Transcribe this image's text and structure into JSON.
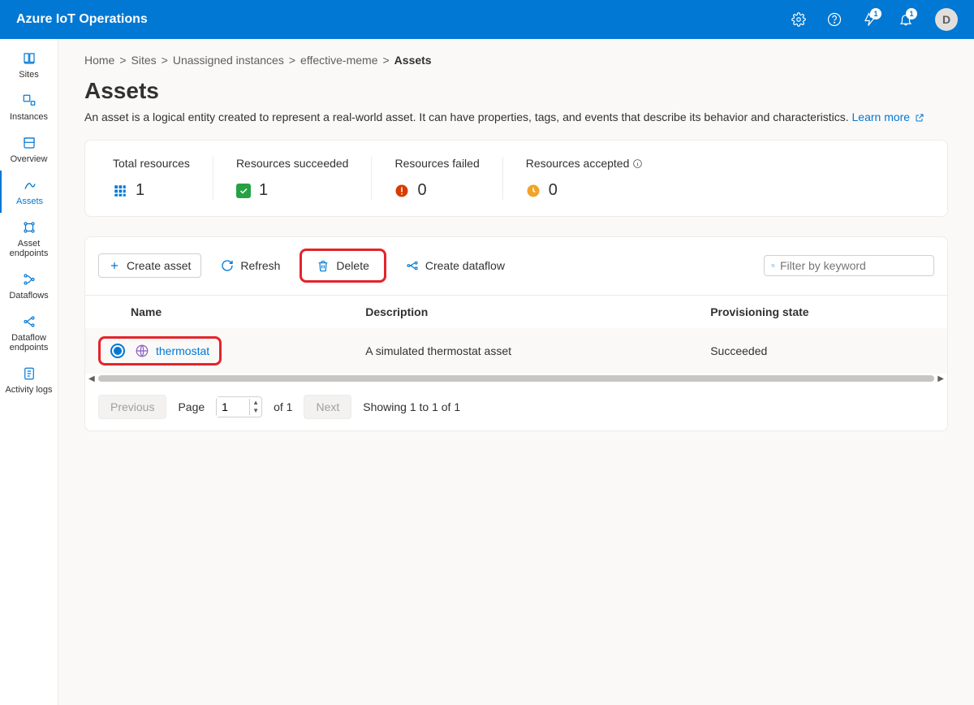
{
  "header": {
    "brand": "Azure IoT Operations",
    "notif1_count": "1",
    "notif2_count": "1",
    "avatar_initial": "D"
  },
  "sidebar": {
    "items": [
      {
        "label": "Sites"
      },
      {
        "label": "Instances"
      },
      {
        "label": "Overview"
      },
      {
        "label": "Assets"
      },
      {
        "label": "Asset endpoints"
      },
      {
        "label": "Dataflows"
      },
      {
        "label": "Dataflow endpoints"
      },
      {
        "label": "Activity logs"
      }
    ]
  },
  "breadcrumbs": {
    "items": [
      "Home",
      "Sites",
      "Unassigned instances",
      "effective-meme"
    ],
    "current": "Assets"
  },
  "page": {
    "title": "Assets",
    "description_prefix": "An asset is a logical entity created to represent a real-world asset. It can have properties, tags, and events that describe its behavior and characteristics. ",
    "learn_more": "Learn more"
  },
  "stats": {
    "total": {
      "label": "Total resources",
      "value": "1"
    },
    "succeeded": {
      "label": "Resources succeeded",
      "value": "1"
    },
    "failed": {
      "label": "Resources failed",
      "value": "0"
    },
    "accepted": {
      "label": "Resources accepted",
      "value": "0"
    }
  },
  "toolbar": {
    "create": "Create asset",
    "refresh": "Refresh",
    "delete": "Delete",
    "dataflow": "Create dataflow",
    "filter_placeholder": "Filter by keyword"
  },
  "table": {
    "headers": {
      "name": "Name",
      "desc": "Description",
      "state": "Provisioning state"
    },
    "rows": [
      {
        "name": "thermostat",
        "desc": "A simulated thermostat asset",
        "state": "Succeeded",
        "selected": true
      }
    ]
  },
  "pager": {
    "prev": "Previous",
    "next": "Next",
    "page_label": "Page",
    "page_value": "1",
    "of": "of 1",
    "showing": "Showing 1 to 1 of 1"
  }
}
